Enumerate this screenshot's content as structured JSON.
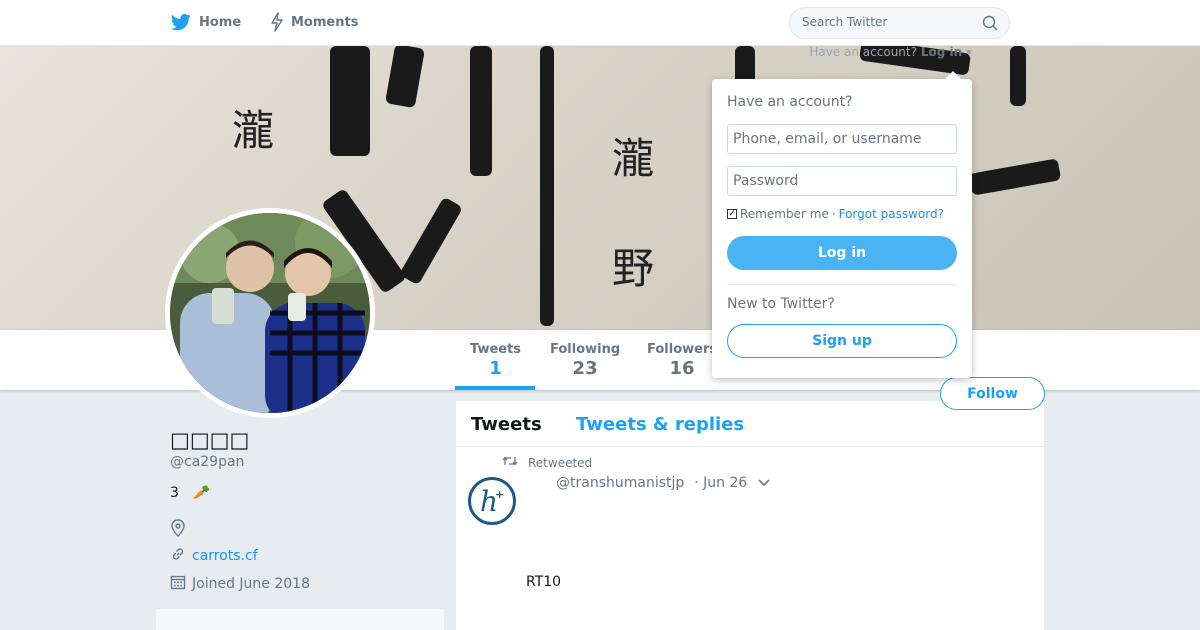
{
  "nav": {
    "home_label": "Home",
    "moments_label": "Moments",
    "search_placeholder": "Search Twitter",
    "login_prompt": "Have an account?",
    "login_link": "Log in"
  },
  "banner": {
    "kanji": [
      "瀧",
      "瀧",
      "野"
    ]
  },
  "profile": {
    "name": "□□□□",
    "handle": "@ca29pan",
    "bio_number": "3",
    "bio_emoji": "🥕",
    "website": "carrots.cf",
    "joined": "Joined June 2018"
  },
  "stats": [
    {
      "label": "Tweets",
      "value": "1"
    },
    {
      "label": "Following",
      "value": "23"
    },
    {
      "label": "Followers",
      "value": "16"
    }
  ],
  "follow_label": "Follow",
  "timeline": {
    "tab_tweets": "Tweets",
    "tab_replies": "Tweets & replies",
    "retweeted_label": "Retweeted",
    "tweet_handle": "@transhumanistjp",
    "tweet_date": "· Jun 26",
    "tweet_text": "RT10"
  },
  "login_dropdown": {
    "title": "Have an account?",
    "username_placeholder": "Phone, email, or username",
    "password_placeholder": "Password",
    "remember_label": "Remember me",
    "separator": "·",
    "forgot_label": "Forgot password?",
    "login_button": "Log in",
    "new_label": "New to Twitter?",
    "signup_button": "Sign up"
  },
  "colors": {
    "accent": "#1da1f2",
    "link": "#1b95e0",
    "background": "#e6ecf0"
  }
}
